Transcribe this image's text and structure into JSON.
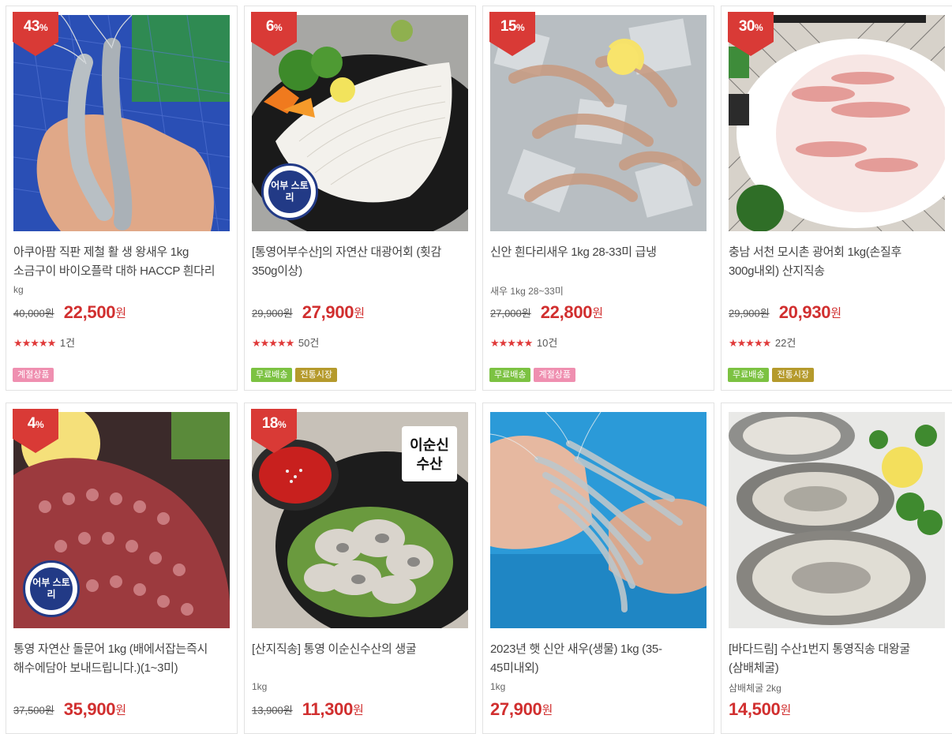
{
  "colors": {
    "sale": "#d12f2f",
    "discount_ribbon": "#d93a36",
    "tag_free": "#7cc242",
    "tag_season": "#ef8fb0",
    "tag_market": "#b59a2c"
  },
  "products": [
    {
      "discount": "43",
      "discount_unit": "%",
      "title": "아쿠아팜 직판 제철 활 생 왕새우 1kg 소금구이 바이오플락 대하 HACCP 흰다리",
      "subtitle": "kg",
      "orig_price": "40,000원",
      "sale_price": "22,500",
      "won": "원",
      "stars": "★★★★★",
      "review_count": "1건",
      "tags": [
        {
          "label": "계절상품",
          "kind": "season"
        }
      ]
    },
    {
      "discount": "6",
      "discount_unit": "%",
      "title": "[통영어부수산]의 자연산 대광어회 (횟감 350g이상)",
      "subtitle": "",
      "orig_price": "29,900원",
      "sale_price": "27,900",
      "won": "원",
      "stars": "★★★★★",
      "review_count": "50건",
      "tags": [
        {
          "label": "무료배송",
          "kind": "free"
        },
        {
          "label": "전통시장",
          "kind": "market"
        }
      ],
      "logo_text": "어부 스토리"
    },
    {
      "discount": "15",
      "discount_unit": "%",
      "title": "신안 흰다리새우 1kg 28-33미 급냉",
      "subtitle": "새우 1kg 28~33미",
      "orig_price": "27,000원",
      "sale_price": "22,800",
      "won": "원",
      "stars": "★★★★★",
      "review_count": "10건",
      "tags": [
        {
          "label": "무료배송",
          "kind": "free"
        },
        {
          "label": "계절상품",
          "kind": "season"
        }
      ]
    },
    {
      "discount": "30",
      "discount_unit": "%",
      "title": "충남 서천 모시촌 광어회 1kg(손질후 300g내외) 산지직송",
      "subtitle": "",
      "orig_price": "29,900원",
      "sale_price": "20,930",
      "won": "원",
      "stars": "★★★★★",
      "review_count": "22건",
      "tags": [
        {
          "label": "무료배송",
          "kind": "free"
        },
        {
          "label": "전통시장",
          "kind": "market"
        }
      ]
    },
    {
      "discount": "4",
      "discount_unit": "%",
      "title": "통영 자연산 돌문어 1kg (배에서잡는즉시 해수에담아 보내드립니다.)(1~3미)",
      "subtitle": "",
      "orig_price": "37,500원",
      "sale_price": "35,900",
      "won": "원",
      "logo_text": "어부 스토리"
    },
    {
      "discount": "18",
      "discount_unit": "%",
      "title": "[산지직송] 통영 이순신수산의 생굴",
      "subtitle": "1kg",
      "orig_price": "13,900원",
      "sale_price": "11,300",
      "won": "원",
      "brand_text": "이순신 수산"
    },
    {
      "discount": "",
      "discount_unit": "",
      "title": "2023년 햇 신안 새우(생물) 1kg (35-45미내외)",
      "subtitle": "1kg",
      "orig_price": "",
      "sale_price": "27,900",
      "won": "원"
    },
    {
      "discount": "",
      "discount_unit": "",
      "title": "[바다드림] 수산1번지 통영직송 대왕굴(삼배체굴)",
      "subtitle": "삼배체굴 2kg",
      "orig_price": "",
      "sale_price": "14,500",
      "won": "원"
    }
  ]
}
